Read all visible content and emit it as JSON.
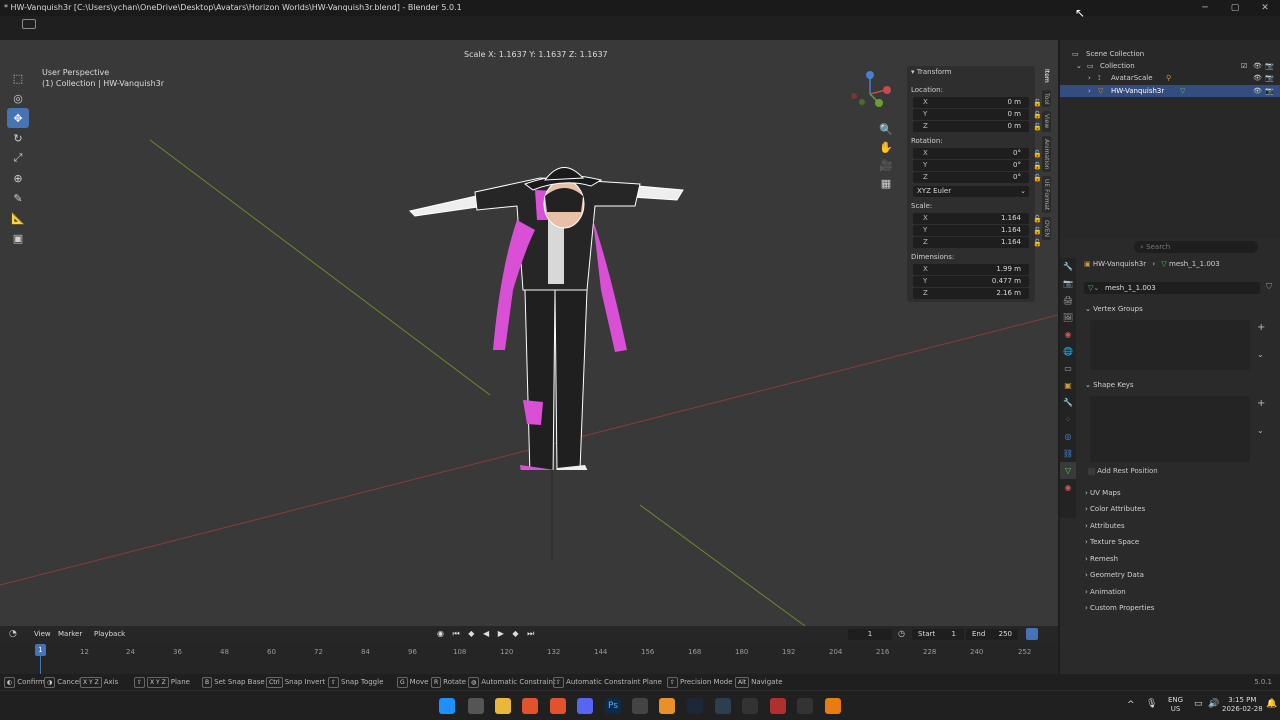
{
  "window": {
    "title": "* HW-Vanquish3r [C:\\Users\\ychan\\OneDrive\\Desktop\\Avatars\\Horizon Worlds\\HW-Vanquish3r.blend] - Blender 5.0.1"
  },
  "viewport": {
    "perspective_label": "User Perspective",
    "collection_label": "(1) Collection | HW-Vanquish3r",
    "scale_readout": "Scale X: 1.1637   Y: 1.1637  Z: 1.1637"
  },
  "npanel": {
    "title": "Transform",
    "location_label": "Location:",
    "location": [
      {
        "axis": "X",
        "value": "0 m"
      },
      {
        "axis": "Y",
        "value": "0 m"
      },
      {
        "axis": "Z",
        "value": "0 m"
      }
    ],
    "rotation_label": "Rotation:",
    "rotation": [
      {
        "axis": "X",
        "value": "0°"
      },
      {
        "axis": "Y",
        "value": "0°"
      },
      {
        "axis": "Z",
        "value": "0°"
      }
    ],
    "rotation_mode": "XYZ Euler",
    "scale_label": "Scale:",
    "scale": [
      {
        "axis": "X",
        "value": "1.164"
      },
      {
        "axis": "Y",
        "value": "1.164"
      },
      {
        "axis": "Z",
        "value": "1.164"
      }
    ],
    "dimensions_label": "Dimensions:",
    "dimensions": [
      {
        "axis": "X",
        "value": "1.99 m"
      },
      {
        "axis": "Y",
        "value": "0.477 m"
      },
      {
        "axis": "Z",
        "value": "2.16 m"
      }
    ],
    "side_tabs": [
      "Item",
      "Tool",
      "View",
      "Animation",
      "UE Format",
      "OVEN"
    ]
  },
  "outliner": {
    "scene_collection": "Scene Collection",
    "collection": "Collection",
    "item1": "AvatarScale",
    "item2": "HW-Vanquish3r"
  },
  "properties": {
    "search_placeholder": "Search",
    "breadcrumb_object": "HW-Vanquish3r",
    "breadcrumb_mesh": "mesh_1_1.003",
    "datablock_name": "mesh_1_1.003",
    "vertex_groups": "Vertex Groups",
    "shape_keys": "Shape Keys",
    "add_rest_position": "Add Rest Position",
    "panels": [
      "UV Maps",
      "Color Attributes",
      "Attributes",
      "Texture Space",
      "Remesh",
      "Geometry Data",
      "Animation",
      "Custom Properties"
    ]
  },
  "timeline": {
    "menus": [
      "View",
      "Marker",
      "Playback"
    ],
    "current_frame": "1",
    "start_label": "Start",
    "start_value": "1",
    "end_label": "End",
    "end_value": "250",
    "ruler_ticks": [
      "1",
      "12",
      "24",
      "36",
      "48",
      "60",
      "72",
      "84",
      "96",
      "108",
      "120",
      "132",
      "144",
      "156",
      "168",
      "180",
      "192",
      "204",
      "216",
      "228",
      "240",
      "252"
    ]
  },
  "statusbar": {
    "items": [
      {
        "key": "",
        "label": "Confirm"
      },
      {
        "key": "",
        "label": "Cancel"
      },
      {
        "key": "X Y Z",
        "label": "Axis"
      },
      {
        "key": "X Y Z",
        "label": "Plane"
      },
      {
        "key": "B",
        "label": "Set Snap Base"
      },
      {
        "key": "Ctrl",
        "label": "Snap Invert"
      },
      {
        "key": "",
        "label": "Snap Toggle"
      },
      {
        "key": "G",
        "label": "Move"
      },
      {
        "key": "R",
        "label": "Rotate"
      },
      {
        "key": "",
        "label": "Automatic Constraint"
      },
      {
        "key": "",
        "label": "Automatic Constraint Plane"
      },
      {
        "key": "",
        "label": "Precision Mode"
      },
      {
        "key": "Alt",
        "label": "Navigate"
      }
    ],
    "version": "5.0.1"
  },
  "taskbar": {
    "lang": "ENG",
    "region": "US",
    "time": "3:15 PM",
    "date": "2026-02-28"
  },
  "colors": {
    "accent": "#4772b3",
    "viewport_bg": "#393939",
    "selected_row": "#334d80",
    "avatar_magenta": "#d94fd6"
  }
}
